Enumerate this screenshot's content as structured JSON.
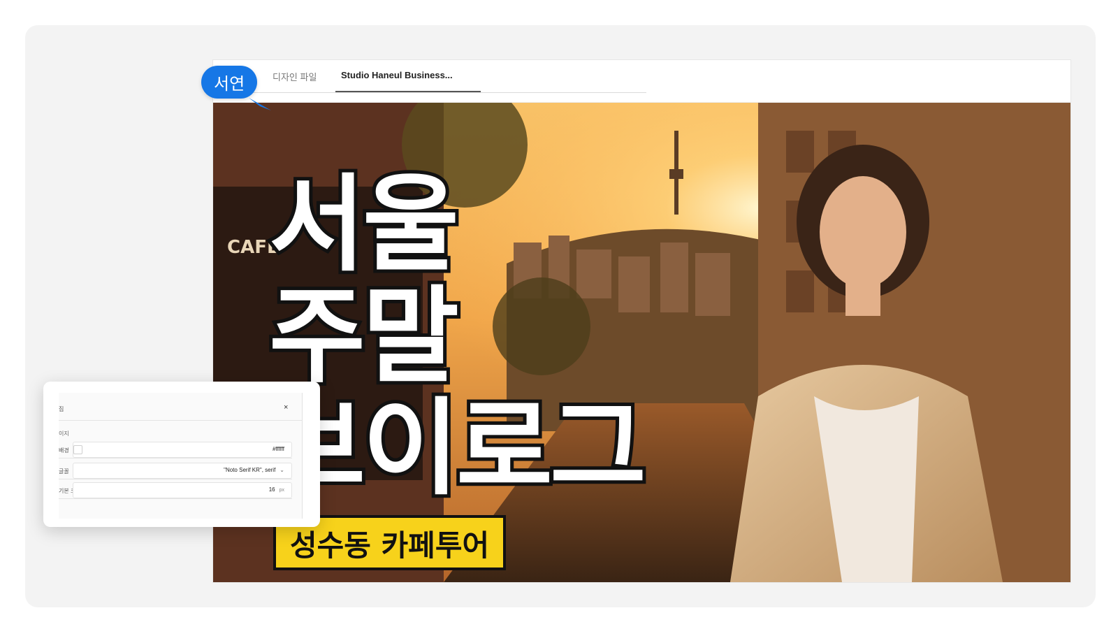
{
  "cursor": {
    "name": "서연",
    "color": "#1677e6"
  },
  "tabs": {
    "items": [
      {
        "label": "디자인 파일"
      },
      {
        "label": "Studio Haneul Business..."
      }
    ]
  },
  "thumbnail": {
    "headline_lines": [
      "서울",
      "주말",
      "브이로그"
    ],
    "subtitle": "성수동 카페투어",
    "sign_text": "CAFE",
    "subtitle_bg": "#f7d21b"
  },
  "panel": {
    "title": "집",
    "close_symbol": "×",
    "section": "이지",
    "rows": [
      {
        "label": "배경",
        "value": "#ffffff"
      },
      {
        "label": "글꼴",
        "value": "\"Noto Serif KR\", serif"
      },
      {
        "label": "기본 크기",
        "value": "16",
        "unit": "px"
      }
    ]
  }
}
